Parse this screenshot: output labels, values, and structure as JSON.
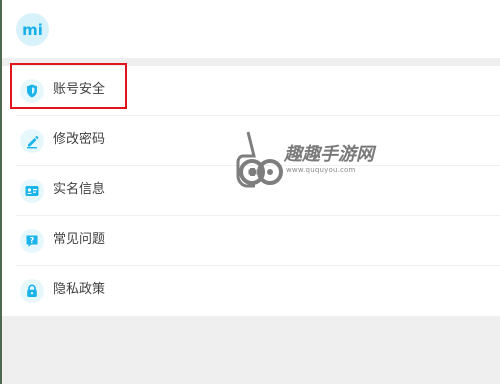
{
  "menu": {
    "items": [
      {
        "label": "账号安全",
        "icon": "shield-icon"
      },
      {
        "label": "修改密码",
        "icon": "pencil-icon"
      },
      {
        "label": "实名信息",
        "icon": "id-card-icon"
      },
      {
        "label": "常见问题",
        "icon": "question-icon"
      },
      {
        "label": "隐私政策",
        "icon": "lock-icon"
      }
    ]
  },
  "watermark": {
    "text": "趣趣手游网",
    "url": "www.ququyou.com"
  },
  "colors": {
    "accent": "#1ab3ea",
    "icon_bg": "#e7f8fd",
    "highlight": "#e0141a"
  }
}
